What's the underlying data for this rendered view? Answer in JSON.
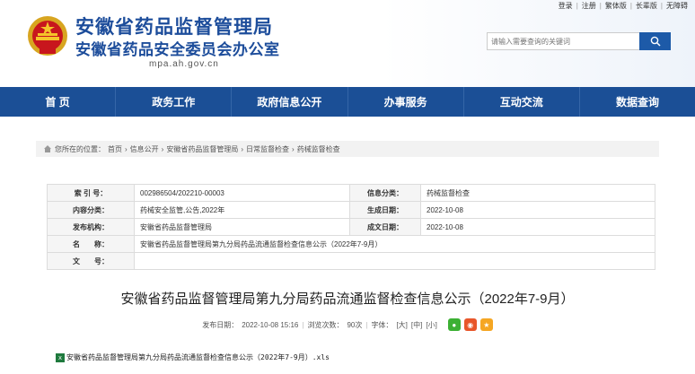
{
  "topbar": {
    "links": [
      "登录",
      "注册",
      "繁体版",
      "长辈版",
      "无障碍"
    ]
  },
  "header": {
    "name_line1": "安徽省药品监督管理局",
    "name_line2": "安徽省药品安全委员会办公室",
    "domain": "mpa.ah.gov.cn",
    "search_placeholder": "请输入需要查询的关键词"
  },
  "nav": [
    "首 页",
    "政务工作",
    "政府信息公开",
    "办事服务",
    "互动交流",
    "数据查询"
  ],
  "breadcrumb": {
    "prefix": "您所在的位置：",
    "items": [
      "首页",
      "信息公开",
      "安徽省药品监督管理局",
      "日常监督检查",
      "药械监督检查"
    ]
  },
  "meta": {
    "index_label": "索 引 号：",
    "index_value": "002986504/202210-00003",
    "category_label": "信息分类：",
    "category_value": "药械监督检查",
    "topic_label": "内容分类：",
    "topic_value": "药械安全监管,公告,2022年",
    "gen_date_label": "生成日期：",
    "gen_date_value": "2022-10-08",
    "publisher_label": "发布机构：",
    "publisher_value": "安徽省药品监督管理局",
    "done_date_label": "成文日期：",
    "done_date_value": "2022-10-08",
    "name_label": "名　　称：",
    "name_value": "安徽省药品监督管理局第九分局药品流通监督检查信息公示（2022年7-9月）",
    "docno_label": "文　　号：",
    "docno_value": ""
  },
  "document": {
    "title": "安徽省药品监督管理局第九分局药品流通监督检查信息公示（2022年7-9月）",
    "published_label": "发布日期：",
    "published_value": "2022-10-08 15:16",
    "views_label": "浏览次数：",
    "views_value": "90次",
    "font_label": "字体：",
    "font_large": "[大]",
    "font_medium": "[中]",
    "font_small": "[小]",
    "attachment": "安徽省药品监督管理局第九分局药品流通监督检查信息公示（2022年7-9月）.xls"
  },
  "colors": {
    "nav_bg": "#1b4f96",
    "title_blue": "#1d4d9b",
    "wechat": "#3cb034",
    "weibo": "#e8562a",
    "qzone": "#f5a623"
  }
}
